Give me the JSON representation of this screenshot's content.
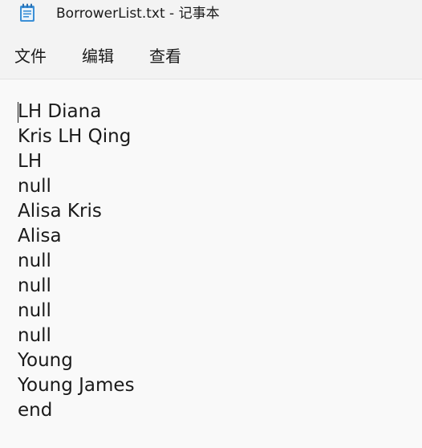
{
  "window": {
    "title": "BorrowerList.txt - 记事本",
    "icon": "notepad-icon"
  },
  "menu": {
    "file": "文件",
    "edit": "编辑",
    "view": "查看"
  },
  "document": {
    "lines": [
      "LH Diana",
      "Kris LH Qing",
      "LH",
      "null",
      "Alisa Kris",
      "Alisa",
      "null",
      "null",
      "null",
      "null",
      "Young",
      "Young James",
      "end"
    ]
  }
}
